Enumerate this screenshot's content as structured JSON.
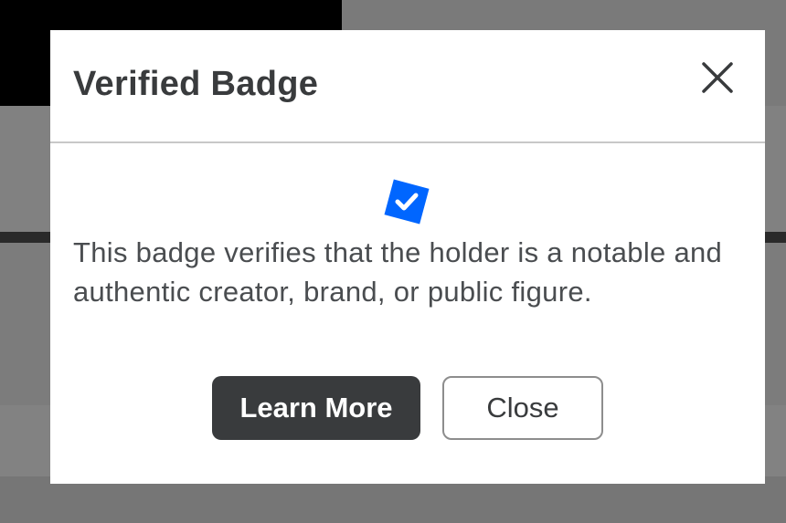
{
  "dialog": {
    "title": "Verified Badge",
    "close_icon": "close-x-icon",
    "badge_icon": "verified-check-badge-icon",
    "badge_color": "#0066ff",
    "description": "This badge verifies that the holder is a notable and authentic creator, brand, or public figure.",
    "buttons": {
      "learn_more_label": "Learn More",
      "close_label": "Close"
    }
  }
}
